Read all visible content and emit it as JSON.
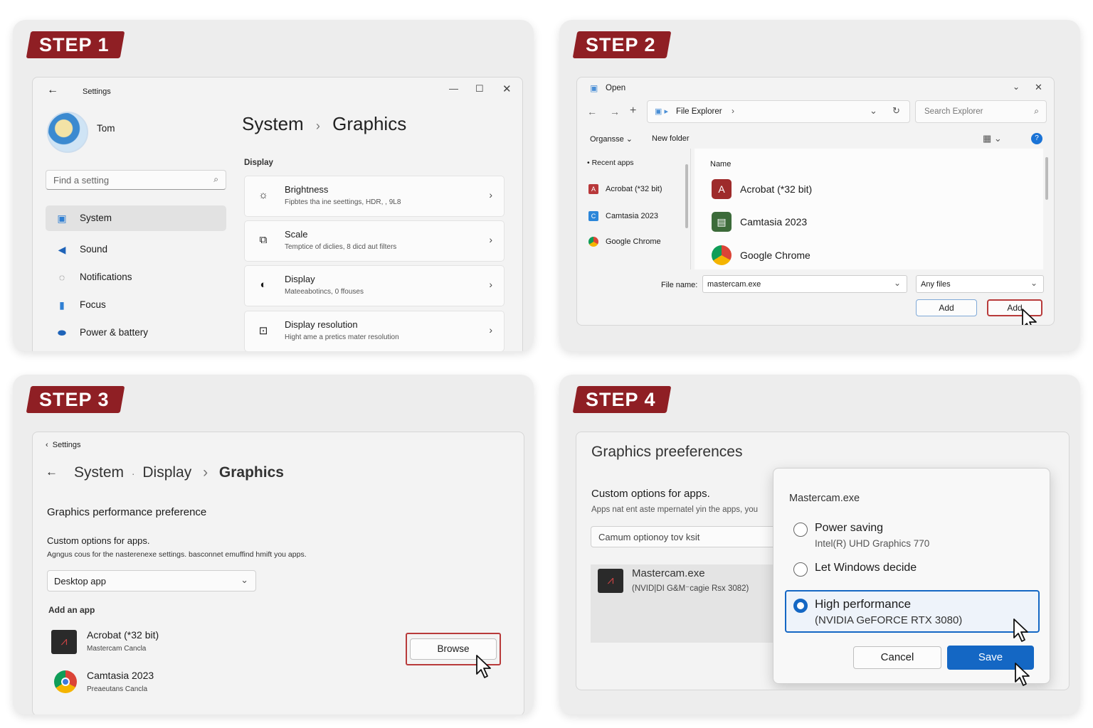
{
  "steps": [
    "STEP 1",
    "STEP 2",
    "STEP 3",
    "STEP 4"
  ],
  "colors": {
    "step_badge": "#8f1f24",
    "accent": "#1467c4",
    "highlight_border": "#b83a3a"
  },
  "step1": {
    "window_title": "Settings",
    "user_name": "Tom",
    "search_placeholder": "Find a setting",
    "breadcrumb": {
      "parent": "System",
      "sep": "›",
      "current": "Graphics"
    },
    "nav": [
      {
        "label": "System",
        "icon": "monitor-icon",
        "selected": true
      },
      {
        "label": "Sound",
        "icon": "speaker-icon"
      },
      {
        "label": "Notifications",
        "icon": "bell-icon"
      },
      {
        "label": "Focus",
        "icon": "focus-icon"
      },
      {
        "label": "Power & battery",
        "icon": "battery-icon"
      }
    ],
    "section": "Display",
    "cards": [
      {
        "title": "Brightness",
        "subtitle": "Fipbtes tha ine seettings, HDR, , 9L8",
        "icon": "sun-icon"
      },
      {
        "title": "Scale",
        "subtitle": "Temptice of diclies, 8 dicd aut filters",
        "icon": "scale-icon"
      },
      {
        "title": "Display",
        "subtitle": "Mateeabotincs, 0 ffouses",
        "icon": "display-icon"
      },
      {
        "title": "Display resolution",
        "subtitle": "Hight ame a pretics mater resolution",
        "icon": "resolution-icon"
      }
    ]
  },
  "step2": {
    "dialog_title": "Open",
    "address": "File Explorer",
    "search_placeholder": "Search Explorer",
    "toolbar": {
      "organise": "Organsse",
      "new_folder": "New folder"
    },
    "sidebar_header": "Recent apps",
    "sidebar_apps": [
      "Acrobat (*32 bit)",
      "Camtasia 2023",
      "Google Chrome"
    ],
    "column_name": "Name",
    "apps": [
      "Acrobat (*32 bit)",
      "Camtasia 2023",
      "Google Chrome"
    ],
    "file_name_label": "File name:",
    "file_name_value": "mastercam.exe",
    "file_type": "Any files",
    "btn_add_secondary": "Add",
    "btn_add_primary": "Add"
  },
  "step3": {
    "back_label": "Settings",
    "breadcrumb": {
      "a": "System",
      "b": "Display",
      "sep1": "·",
      "sep2": "›",
      "current": "Graphics"
    },
    "heading": "Graphics performance preference",
    "custom_title": "Custom options for apps.",
    "custom_desc": "Agngus cous for the nasterenexe settings. basconnet emuffind hmift you apps.",
    "dropdown": "Desktop app",
    "add_label": "Add an app",
    "apps": [
      {
        "name": "Acrobat (*32 bit)",
        "sub": "Mastercam Cancla"
      },
      {
        "name": "Camtasia 2023",
        "sub": "Preaeutans Cancla"
      }
    ],
    "browse": "Browse"
  },
  "step4": {
    "title": "Graphics preeferences",
    "custom_title": "Custom options for apps.",
    "custom_desc": "Apps nat ent aste mpernatel yin the apps, you",
    "input_value": "Camum optionoy tov ksit",
    "app_name": "Mastercam.exe",
    "app_sub": "(NVID|DI G&M⁻cagie Rsx 3082)",
    "popup_title": "Mastercam.exe",
    "options": [
      {
        "label": "Power saving",
        "sub": "Intel(R) UHD Graphics 770",
        "selected": false
      },
      {
        "label": "Let Windows decide",
        "sub": "",
        "selected": false
      },
      {
        "label": "High performance",
        "sub": "(NVIDIA GeFORCE RTX 3080)",
        "selected": true
      }
    ],
    "cancel": "Cancel",
    "save": "Save"
  }
}
